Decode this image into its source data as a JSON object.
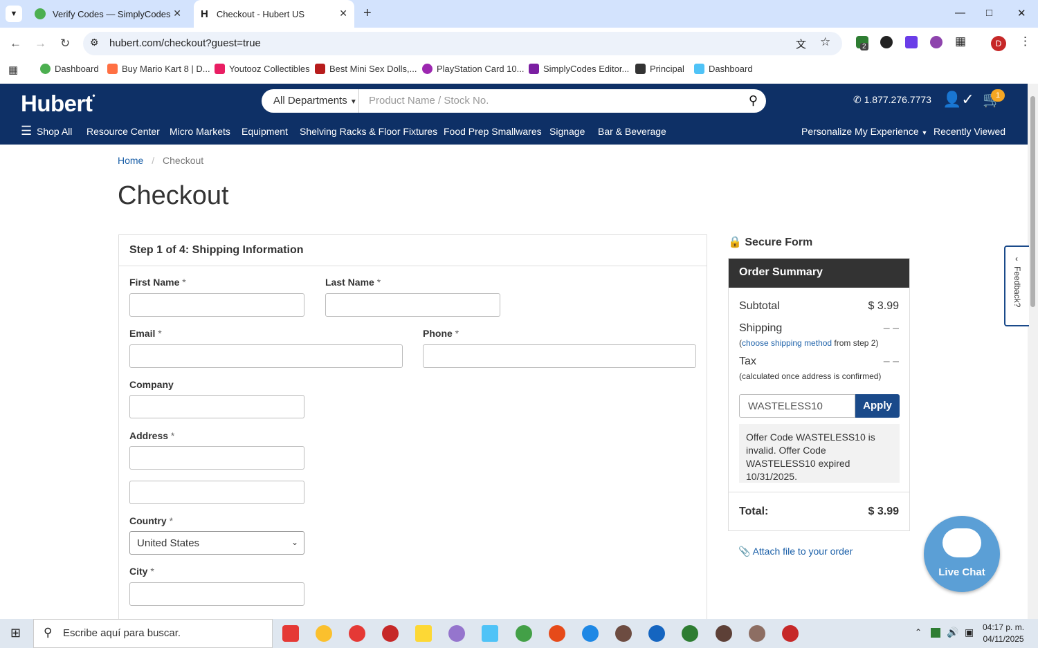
{
  "browser": {
    "tabs": [
      {
        "title": "Verify Codes — SimplyCodes",
        "active": false
      },
      {
        "title": "Checkout - Hubert US",
        "active": true
      }
    ],
    "url": "hubert.com/checkout?guest=true",
    "bookmarks": [
      "Dashboard",
      "Buy Mario Kart 8 | D...",
      "Youtooz Collectibles",
      "Best Mini Sex Dolls,...",
      "PlayStation Card 10...",
      "SimplyCodes Editor...",
      "Principal",
      "Dashboard"
    ],
    "extension_badge": "2",
    "profile_initial": "D"
  },
  "header": {
    "logo": "Hubert",
    "department_select": "All Departments",
    "search_placeholder": "Product Name / Stock No.",
    "phone": "1.877.276.7773",
    "cart_count": "1",
    "nav": [
      "Shop All",
      "Resource Center",
      "Micro Markets",
      "Equipment",
      "Shelving Racks & Floor Fixtures",
      "Food Prep Smallwares",
      "Signage",
      "Bar & Beverage",
      "Personalize My Experience",
      "Recently Viewed"
    ]
  },
  "breadcrumb": {
    "home": "Home",
    "sep": "/",
    "current": "Checkout"
  },
  "page_title": "Checkout",
  "form": {
    "step_title": "Step 1 of 4: Shipping Information",
    "labels": {
      "first_name": "First Name",
      "last_name": "Last Name",
      "email": "Email",
      "phone": "Phone",
      "company": "Company",
      "address": "Address",
      "country": "Country",
      "city": "City"
    },
    "required_mark": "*",
    "country_value": "United States"
  },
  "summary": {
    "secure": "Secure Form",
    "title": "Order Summary",
    "subtotal_label": "Subtotal",
    "subtotal_value": "$ 3.99",
    "shipping_label": "Shipping",
    "shipping_value": "– –",
    "shipping_note_open": "(",
    "shipping_note_link": "choose shipping method",
    "shipping_note_rest": " from step 2)",
    "tax_label": "Tax",
    "tax_value": "– –",
    "tax_note": "(calculated once address is confirmed)",
    "coupon_value": "WASTELESS10",
    "apply_label": "Apply",
    "message": "Offer Code WASTELESS10 is invalid. Offer Code WASTELESS10 expired 10/31/2025.",
    "total_label": "Total:",
    "total_value": "$ 3.99"
  },
  "attach_label": "Attach file to your order",
  "feedback_label": "Feedback?",
  "live_chat_label": "Live Chat",
  "taskbar": {
    "search_placeholder": "Escribe aquí para buscar.",
    "time": "04:17 p. m.",
    "date": "04/11/2025"
  }
}
